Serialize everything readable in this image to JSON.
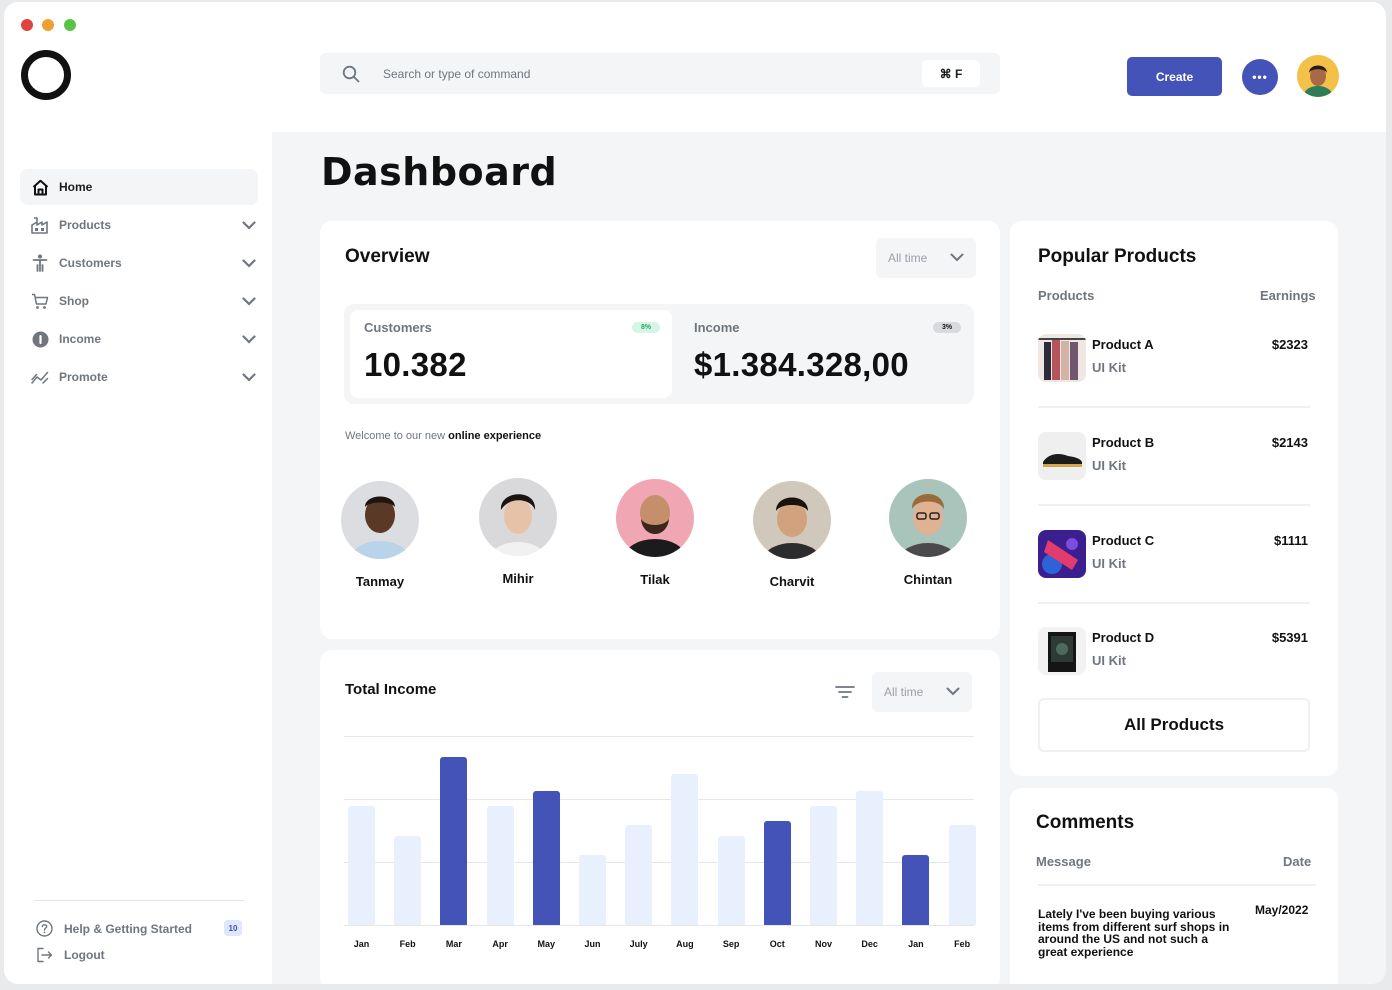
{
  "colors": {
    "accent": "#4353b7",
    "bar_light": "#e8f0fd",
    "bar_dark": "#4353b7",
    "badge_green": "#d7f5e6",
    "badge_gray": "#d9dadd"
  },
  "search": {
    "placeholder": "Search or type of command",
    "shortcut": "⌘ F"
  },
  "header": {
    "create_label": "Create",
    "messages_label": "•••"
  },
  "sidebar": {
    "items": [
      {
        "label": "Home",
        "icon": "home-icon"
      },
      {
        "label": "Products",
        "icon": "products-icon"
      },
      {
        "label": "Customers",
        "icon": "customers-icon"
      },
      {
        "label": "Shop",
        "icon": "cart-icon"
      },
      {
        "label": "Income",
        "icon": "income-icon"
      },
      {
        "label": "Promote",
        "icon": "promote-icon"
      }
    ],
    "help_label": "Help & Getting Started",
    "help_count": "10",
    "logout_label": "Logout"
  },
  "page": {
    "title": "Dashboard"
  },
  "overview": {
    "title": "Overview",
    "filter": "All time",
    "customers": {
      "label": "Customers",
      "value": "10.382",
      "badge": "8%"
    },
    "income": {
      "label": "Income",
      "value": "$1.384.328,00",
      "badge": "3%"
    },
    "welcome_prefix": "Welcome to our new",
    "welcome_bold": "online experience",
    "people": [
      "Tanmay",
      "Mihir",
      "Tilak",
      "Charvit",
      "Chintan"
    ]
  },
  "total_income": {
    "title": "Total Income",
    "filter": "All time"
  },
  "chart_data": {
    "type": "bar",
    "title": "Total Income",
    "categories": [
      "Jan",
      "Feb",
      "Mar",
      "Apr",
      "May",
      "Jun",
      "July",
      "Aug",
      "Sep",
      "Oct",
      "Nov",
      "Dec",
      "Jan",
      "Feb"
    ],
    "values": [
      63,
      47,
      89,
      63,
      71,
      37,
      53,
      80,
      47,
      55,
      63,
      71,
      37,
      53
    ],
    "highlighted": [
      false,
      false,
      true,
      false,
      true,
      false,
      false,
      false,
      false,
      true,
      false,
      false,
      true,
      false
    ],
    "ylim": [
      0,
      100
    ],
    "grid": true
  },
  "popular": {
    "title": "Popular Products",
    "col_products": "Products",
    "col_earnings": "Earnings",
    "items": [
      {
        "name": "Product A",
        "sub": "UI Kit",
        "earnings": "$2323"
      },
      {
        "name": "Product B",
        "sub": "UI Kit",
        "earnings": "$2143"
      },
      {
        "name": "Product C",
        "sub": "UI Kit",
        "earnings": "$1111"
      },
      {
        "name": "Product D",
        "sub": "UI Kit",
        "earnings": "$5391"
      }
    ],
    "all_label": "All Products"
  },
  "comments": {
    "title": "Comments",
    "col_message": "Message",
    "col_date": "Date",
    "items": [
      {
        "message": "Lately I've been buying various items from different surf shops in around the US and not such a great experience",
        "date": "May/2022"
      }
    ]
  }
}
